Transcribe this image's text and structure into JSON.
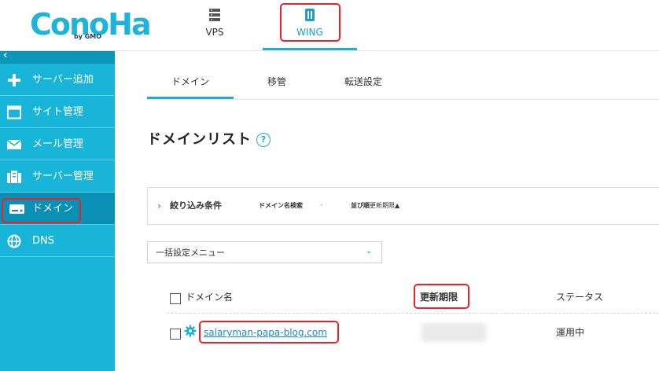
{
  "brand": {
    "logo_text": "ConoHa",
    "logo_sub": "by GMO",
    "accent": "#1ab0d6",
    "highlight": "#e8232a"
  },
  "top_tabs": [
    {
      "label": "VPS",
      "icon": "server-icon"
    },
    {
      "label": "WING",
      "icon": "wing-icon",
      "active": true
    }
  ],
  "sidebar": {
    "collapse_glyph": "‹",
    "items": [
      {
        "label": "サーバー追加",
        "icon": "plus-icon"
      },
      {
        "label": "サイト管理",
        "icon": "window-icon"
      },
      {
        "label": "メール管理",
        "icon": "mail-icon"
      },
      {
        "label": "サーバー管理",
        "icon": "server-icon"
      },
      {
        "label": "ドメイン",
        "icon": "domain-icon",
        "active": true
      },
      {
        "label": "DNS",
        "icon": "globe-icon"
      }
    ]
  },
  "sub_tabs": [
    {
      "label": "ドメイン",
      "active": true
    },
    {
      "label": "移管"
    },
    {
      "label": "転送設定"
    }
  ],
  "page": {
    "title": "ドメインリスト",
    "help_glyph": "?"
  },
  "filter": {
    "chevron": "›",
    "label": "絞り込み条件",
    "search_label": "ドメイン名検索",
    "search_value": "-",
    "sort_label": "並び順",
    "sort_value": "更新期限▲"
  },
  "bulk_menu": {
    "value": "一括設定メニュー",
    "chevron": "⌄"
  },
  "table": {
    "headers": {
      "domain": "ドメイン名",
      "expiry": "更新期限",
      "status": "ステータス"
    },
    "rows": [
      {
        "domain": "salaryman-papa-blog.com",
        "expiry": "",
        "status": "運用中"
      }
    ]
  }
}
